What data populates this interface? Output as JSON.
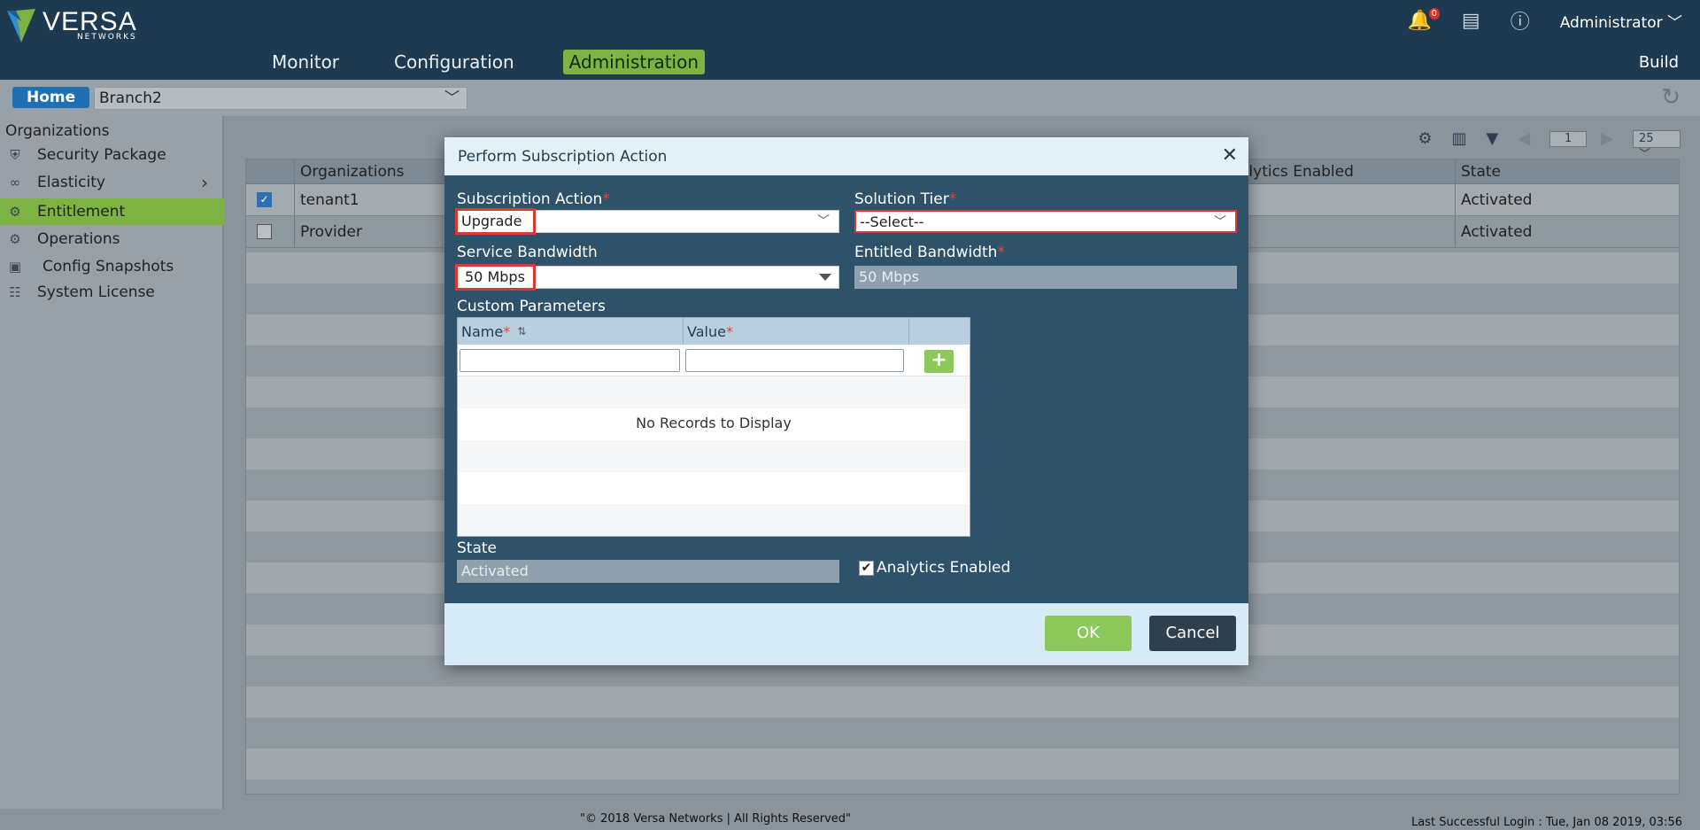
{
  "header": {
    "logo_word": "VERSA",
    "logo_sub": "NETWORKS",
    "nav": [
      "Monitor",
      "Configuration",
      "Administration"
    ],
    "nav_active": "Administration",
    "build_label": "Build",
    "notification_count": "0",
    "user": "Administrator"
  },
  "subbar": {
    "home_label": "Home",
    "branch_value": "Branch2"
  },
  "sidebar": {
    "title": "Organizations",
    "items": [
      {
        "label": "Security Package",
        "icon": "shield-icon"
      },
      {
        "label": "Elasticity",
        "icon": "elasticity-icon"
      },
      {
        "label": "Entitlement",
        "icon": "gear-icon"
      },
      {
        "label": "Operations",
        "icon": "operations-icon"
      },
      {
        "label": "Config Snapshots",
        "icon": "snapshot-icon"
      },
      {
        "label": "System License",
        "icon": "license-icon"
      }
    ],
    "active": "Entitlement"
  },
  "grid": {
    "page": "1",
    "page_size": "25",
    "columns": [
      "Organizations",
      "alytics Enabled",
      "State"
    ],
    "rows": [
      {
        "org": "tenant1",
        "state": "Activated",
        "checked": true
      },
      {
        "org": "Provider",
        "state": "Activated",
        "checked": false
      }
    ]
  },
  "modal": {
    "title": "Perform Subscription Action",
    "subscription_action_label": "Subscription Action",
    "subscription_action_value": "Upgrade",
    "solution_tier_label": "Solution Tier",
    "solution_tier_value": "--Select--",
    "service_bandwidth_label": "Service Bandwidth",
    "service_bandwidth_value": "50 Mbps",
    "entitled_bandwidth_label": "Entitled Bandwidth",
    "entitled_bandwidth_value": "50 Mbps",
    "custom_params_label": "Custom Parameters",
    "col_name": "Name",
    "col_value": "Value",
    "no_records": "No Records to Display",
    "state_label": "State",
    "state_value": "Activated",
    "analytics_label": "Analytics Enabled",
    "analytics_checked": true,
    "ok_label": "OK",
    "cancel_label": "Cancel",
    "required_mark": "*"
  },
  "footer": {
    "copyright": "\"© 2018 Versa Networks | All Rights Reserved\"",
    "last_login": "Last Successful Login : Tue, Jan 08 2019, 03:56"
  },
  "colors": {
    "header_bg": "#1e3a50",
    "accent_green": "#7cb342",
    "modal_bg": "#2d5269",
    "error_red": "#d93a35"
  }
}
